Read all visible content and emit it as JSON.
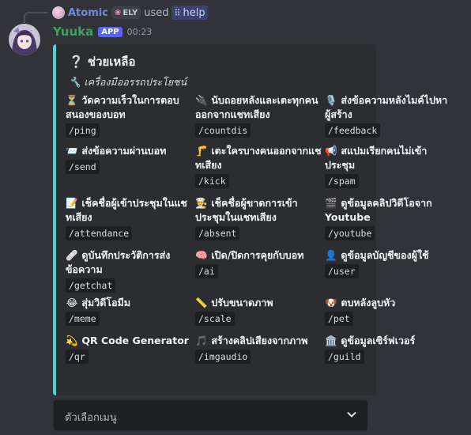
{
  "reply": {
    "username": "Atomic",
    "guild_tag": "ELY",
    "used_text": "used",
    "command": "help"
  },
  "message": {
    "author": "Yuuka",
    "badge": "APP",
    "time": "00:23"
  },
  "embed": {
    "accent_color": "#4ad4d4",
    "title": "❔ ช่วยเหลือ",
    "description": "🔧 เครื่องมืออรรถประโยชน์",
    "fields": [
      {
        "emoji": "⏳",
        "name": "วัดความเร็วในการตอบสนองของบอท",
        "command": "/ping"
      },
      {
        "emoji": "🔌",
        "name": "นับถอยหลังและเตะทุกคนออกจากแชทเสียง",
        "command": "/countdis"
      },
      {
        "emoji": "🎙️",
        "name": "ส่งข้อความหลังไมค์ไปหาผู้สร้าง",
        "command": "/feedback"
      },
      {
        "emoji": "📨",
        "name": "ส่งข้อความผ่านบอท",
        "command": "/send"
      },
      {
        "emoji": "🦵",
        "name": "เตะใครบางคนออกจากแชทเสียง",
        "command": "/kick"
      },
      {
        "emoji": "📢",
        "name": "สแปมเรียกคนไม่เข้าประชุม",
        "command": "/spam"
      },
      {
        "emoji": "📝",
        "name": "เช็คชื่อผู้เข้าประชุมในแชทเสียง",
        "command": "/attendance"
      },
      {
        "emoji": "👨‍🍳",
        "name": "เช็คชื่อผู้ขาดการเข้าประชุมในแชทเสียง",
        "command": "/absent"
      },
      {
        "emoji": "🎬",
        "name": "ดูข้อมูลคลิปวิดีโอจาก Youtube",
        "command": "/youtube"
      },
      {
        "emoji": "🩹",
        "name": "ดูบันทึกประวัติการส่งข้อความ",
        "command": "/getchat"
      },
      {
        "emoji": "🧠",
        "name": "เปิด/ปิดการคุยกับบอท",
        "command": "/ai"
      },
      {
        "emoji": "👤",
        "name": "ดูข้อมูลบัญชีของผู้ใช้",
        "command": "/user"
      },
      {
        "emoji": "😂",
        "name": "สุ่มวิดีโอมีม",
        "command": "/meme"
      },
      {
        "emoji": "📏",
        "name": "ปรับขนาดภาพ",
        "command": "/scale"
      },
      {
        "emoji": "🐶",
        "name": "ตบหลังลูบหัว",
        "command": "/pet"
      },
      {
        "emoji": "💫",
        "name": "QR Code Generator",
        "command": "/qr"
      },
      {
        "emoji": "🎵",
        "name": "สร้างคลิปเสียงจากภาพ",
        "command": "/imgaudio"
      },
      {
        "emoji": "🏛️",
        "name": "ดูข้อมูลเซิร์ฟเวอร์",
        "command": "/guild"
      }
    ]
  },
  "select_menu": {
    "placeholder": "ตัวเลือกเมนู"
  }
}
